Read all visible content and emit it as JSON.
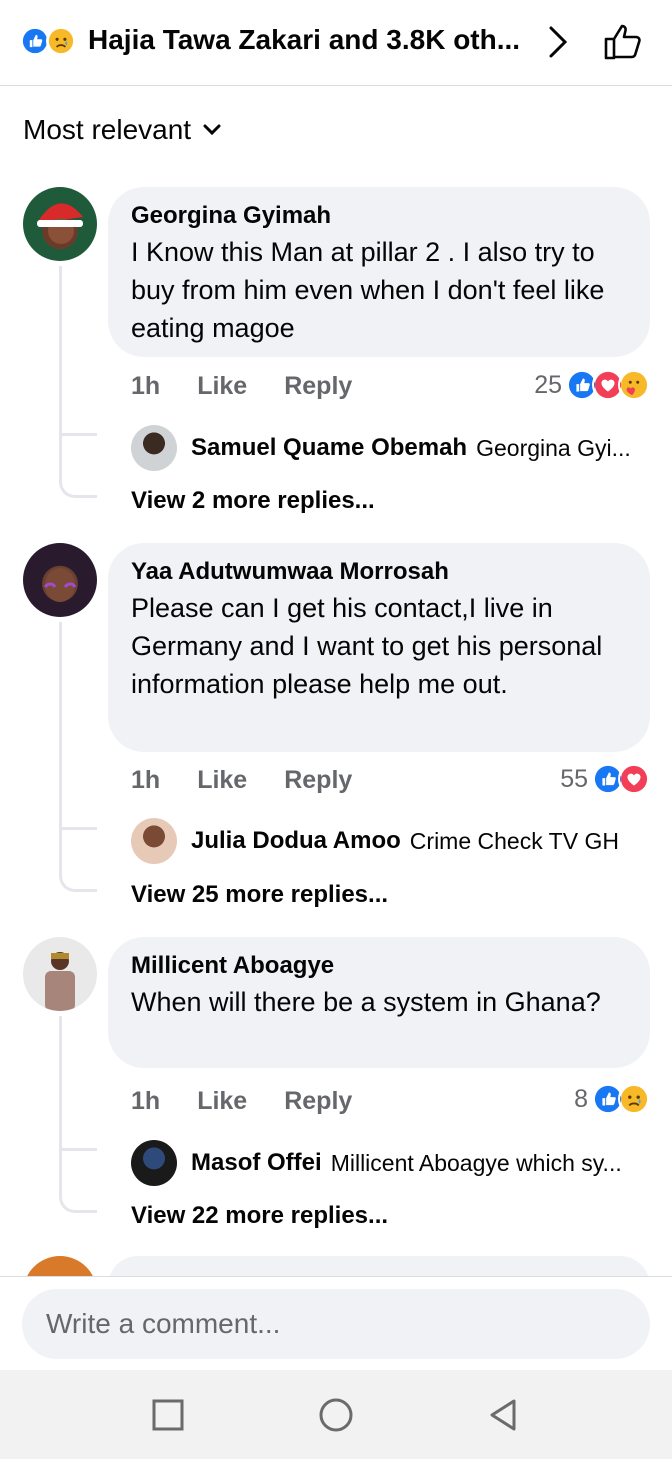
{
  "header": {
    "title": "Hajia Tawa Zakari and 3.8K oth...",
    "reactions": [
      "like-icon",
      "sad-icon"
    ]
  },
  "sort": {
    "label": "Most relevant"
  },
  "comments": [
    {
      "author": "Georgina Gyimah",
      "text": "I Know this Man at pillar 2 . I also try to buy from him even when I don't feel like eating magoe",
      "time": "1h",
      "like_label": "Like",
      "reply_label": "Reply",
      "reaction_count": "25",
      "reactions": [
        "like-icon",
        "love-icon",
        "care-icon"
      ],
      "reply": {
        "author": "Samuel Quame Obemah",
        "text": "Georgina Gyi..."
      },
      "more_replies": "View 2 more replies..."
    },
    {
      "author": "Yaa Adutwumwaa Morrosah",
      "text": "Please can I get his contact,I live in Germany and I want to get his personal information please help me out.",
      "time": "1h",
      "like_label": "Like",
      "reply_label": "Reply",
      "reaction_count": "55",
      "reactions": [
        "like-icon",
        "love-icon"
      ],
      "reply": {
        "author": "Julia Dodua Amoo",
        "text": "Crime Check TV GH"
      },
      "more_replies": "View 25 more replies..."
    },
    {
      "author": "Millicent Aboagye",
      "text": "When will there be a system in Ghana?",
      "time": "1h",
      "like_label": "Like",
      "reply_label": "Reply",
      "reaction_count": "8",
      "reactions": [
        "like-icon",
        "sad-icon"
      ],
      "reply": {
        "author": "Masof Offei",
        "text": "Millicent Aboagye which sy..."
      },
      "more_replies": "View 22 more replies..."
    }
  ],
  "composer": {
    "placeholder": "Write a comment..."
  },
  "colors": {
    "like": "#1877f2",
    "love": "#f33e58",
    "sad": "#f7b928",
    "bubble": "#f0f2f5",
    "meta": "#65676b"
  }
}
